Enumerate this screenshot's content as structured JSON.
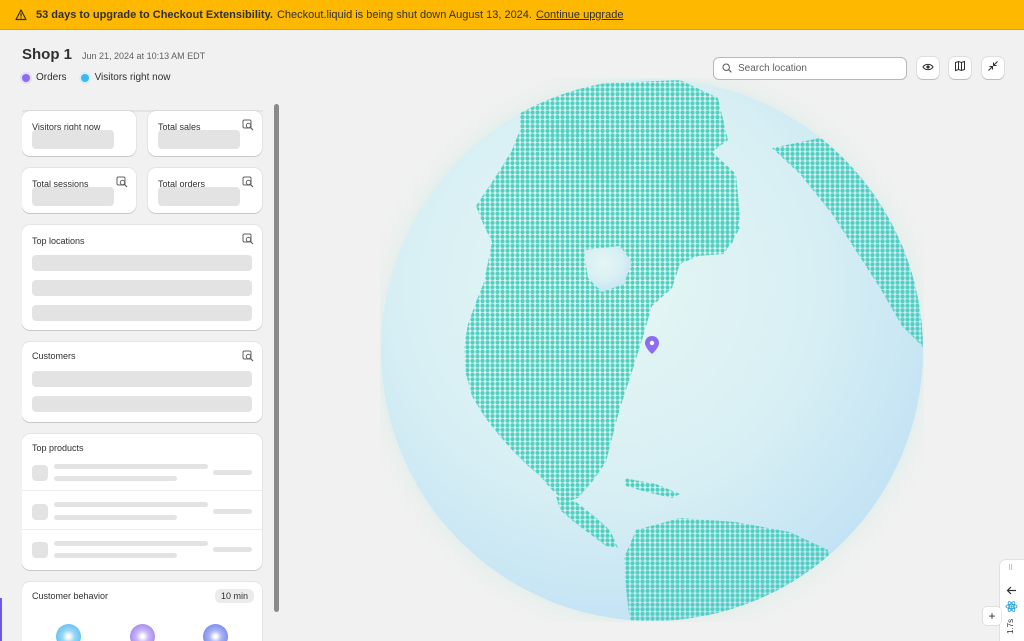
{
  "banner": {
    "bold_text": "53 days to upgrade to Checkout Extensibility.",
    "text": "Checkout.liquid is being shut down August 13, 2024.",
    "link": "Continue upgrade",
    "icon": "warning-icon"
  },
  "header": {
    "title": "Shop 1",
    "date": "Jun 21, 2024 at 10:13 AM EDT"
  },
  "legend": [
    {
      "label": "Orders",
      "color": "#8c6cf0"
    },
    {
      "label": "Visitors right now",
      "color": "#3cb8f0"
    }
  ],
  "cards": {
    "visitors": {
      "label": "Visitors right now"
    },
    "total_sales": {
      "label": "Total sales"
    },
    "total_sessions": {
      "label": "Total sessions"
    },
    "total_orders": {
      "label": "Total orders"
    },
    "top_locations": {
      "label": "Top locations"
    },
    "customers": {
      "label": "Customers"
    },
    "top_products": {
      "label": "Top products"
    },
    "customer_behavior": {
      "label": "Customer behavior",
      "badge": "10 min"
    }
  },
  "toolbar": {
    "search_placeholder": "Search location",
    "view_icon": "eye-icon",
    "map_icon": "map-icon",
    "collapse_icon": "collapse-icon"
  },
  "devtools": {
    "timing": "1.7s",
    "plus": "+"
  },
  "colors": {
    "banner": "#ffb800",
    "land": "#4fd1c0",
    "marker": "#8c6cf0"
  }
}
